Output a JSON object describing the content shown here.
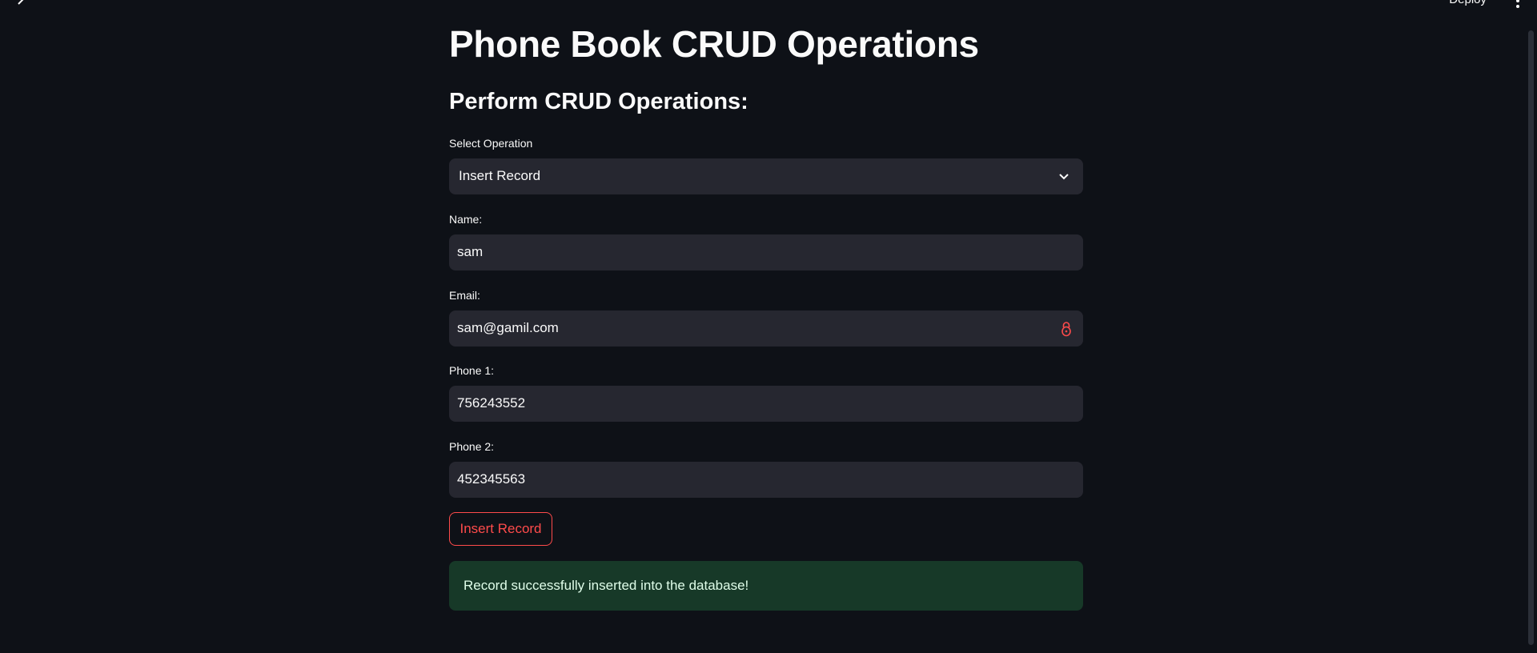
{
  "header": {
    "deploy_label": "Deploy",
    "sidebar_icon": "chevron-right-icon",
    "menu_icon": "vertical-dots-icon"
  },
  "page": {
    "title": "Phone Book CRUD Operations",
    "subtitle": "Perform CRUD Operations:"
  },
  "form": {
    "operation": {
      "label": "Select Operation",
      "value": "Insert Record"
    },
    "name": {
      "label": "Name:",
      "value": "sam"
    },
    "email": {
      "label": "Email:",
      "value": "sam@gamil.com"
    },
    "phone1": {
      "label": "Phone 1:",
      "value": "756243552"
    },
    "phone2": {
      "label": "Phone 2:",
      "value": "452345563"
    },
    "submit_label": "Insert Record"
  },
  "alert": {
    "message": "Record successfully inserted into the database!"
  },
  "colors": {
    "background": "#0e1117",
    "input_bg": "#262730",
    "accent": "#ff4b4b",
    "success_bg": "#173928"
  }
}
